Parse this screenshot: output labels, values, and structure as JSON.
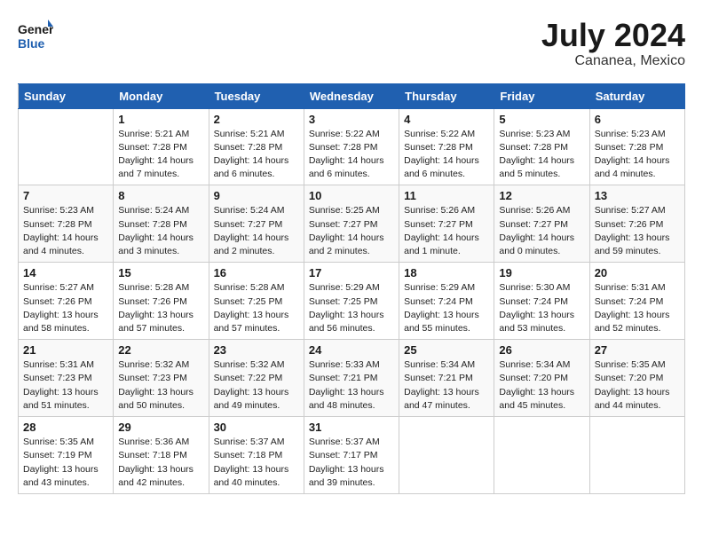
{
  "header": {
    "logo_line1": "General",
    "logo_line2": "Blue",
    "month_title": "July 2024",
    "location": "Cananea, Mexico"
  },
  "weekdays": [
    "Sunday",
    "Monday",
    "Tuesday",
    "Wednesday",
    "Thursday",
    "Friday",
    "Saturday"
  ],
  "weeks": [
    [
      {
        "day": "",
        "info": ""
      },
      {
        "day": "1",
        "info": "Sunrise: 5:21 AM\nSunset: 7:28 PM\nDaylight: 14 hours\nand 7 minutes."
      },
      {
        "day": "2",
        "info": "Sunrise: 5:21 AM\nSunset: 7:28 PM\nDaylight: 14 hours\nand 6 minutes."
      },
      {
        "day": "3",
        "info": "Sunrise: 5:22 AM\nSunset: 7:28 PM\nDaylight: 14 hours\nand 6 minutes."
      },
      {
        "day": "4",
        "info": "Sunrise: 5:22 AM\nSunset: 7:28 PM\nDaylight: 14 hours\nand 6 minutes."
      },
      {
        "day": "5",
        "info": "Sunrise: 5:23 AM\nSunset: 7:28 PM\nDaylight: 14 hours\nand 5 minutes."
      },
      {
        "day": "6",
        "info": "Sunrise: 5:23 AM\nSunset: 7:28 PM\nDaylight: 14 hours\nand 4 minutes."
      }
    ],
    [
      {
        "day": "7",
        "info": "Sunrise: 5:23 AM\nSunset: 7:28 PM\nDaylight: 14 hours\nand 4 minutes."
      },
      {
        "day": "8",
        "info": "Sunrise: 5:24 AM\nSunset: 7:28 PM\nDaylight: 14 hours\nand 3 minutes."
      },
      {
        "day": "9",
        "info": "Sunrise: 5:24 AM\nSunset: 7:27 PM\nDaylight: 14 hours\nand 2 minutes."
      },
      {
        "day": "10",
        "info": "Sunrise: 5:25 AM\nSunset: 7:27 PM\nDaylight: 14 hours\nand 2 minutes."
      },
      {
        "day": "11",
        "info": "Sunrise: 5:26 AM\nSunset: 7:27 PM\nDaylight: 14 hours\nand 1 minute."
      },
      {
        "day": "12",
        "info": "Sunrise: 5:26 AM\nSunset: 7:27 PM\nDaylight: 14 hours\nand 0 minutes."
      },
      {
        "day": "13",
        "info": "Sunrise: 5:27 AM\nSunset: 7:26 PM\nDaylight: 13 hours\nand 59 minutes."
      }
    ],
    [
      {
        "day": "14",
        "info": "Sunrise: 5:27 AM\nSunset: 7:26 PM\nDaylight: 13 hours\nand 58 minutes."
      },
      {
        "day": "15",
        "info": "Sunrise: 5:28 AM\nSunset: 7:26 PM\nDaylight: 13 hours\nand 57 minutes."
      },
      {
        "day": "16",
        "info": "Sunrise: 5:28 AM\nSunset: 7:25 PM\nDaylight: 13 hours\nand 57 minutes."
      },
      {
        "day": "17",
        "info": "Sunrise: 5:29 AM\nSunset: 7:25 PM\nDaylight: 13 hours\nand 56 minutes."
      },
      {
        "day": "18",
        "info": "Sunrise: 5:29 AM\nSunset: 7:24 PM\nDaylight: 13 hours\nand 55 minutes."
      },
      {
        "day": "19",
        "info": "Sunrise: 5:30 AM\nSunset: 7:24 PM\nDaylight: 13 hours\nand 53 minutes."
      },
      {
        "day": "20",
        "info": "Sunrise: 5:31 AM\nSunset: 7:24 PM\nDaylight: 13 hours\nand 52 minutes."
      }
    ],
    [
      {
        "day": "21",
        "info": "Sunrise: 5:31 AM\nSunset: 7:23 PM\nDaylight: 13 hours\nand 51 minutes."
      },
      {
        "day": "22",
        "info": "Sunrise: 5:32 AM\nSunset: 7:23 PM\nDaylight: 13 hours\nand 50 minutes."
      },
      {
        "day": "23",
        "info": "Sunrise: 5:32 AM\nSunset: 7:22 PM\nDaylight: 13 hours\nand 49 minutes."
      },
      {
        "day": "24",
        "info": "Sunrise: 5:33 AM\nSunset: 7:21 PM\nDaylight: 13 hours\nand 48 minutes."
      },
      {
        "day": "25",
        "info": "Sunrise: 5:34 AM\nSunset: 7:21 PM\nDaylight: 13 hours\nand 47 minutes."
      },
      {
        "day": "26",
        "info": "Sunrise: 5:34 AM\nSunset: 7:20 PM\nDaylight: 13 hours\nand 45 minutes."
      },
      {
        "day": "27",
        "info": "Sunrise: 5:35 AM\nSunset: 7:20 PM\nDaylight: 13 hours\nand 44 minutes."
      }
    ],
    [
      {
        "day": "28",
        "info": "Sunrise: 5:35 AM\nSunset: 7:19 PM\nDaylight: 13 hours\nand 43 minutes."
      },
      {
        "day": "29",
        "info": "Sunrise: 5:36 AM\nSunset: 7:18 PM\nDaylight: 13 hours\nand 42 minutes."
      },
      {
        "day": "30",
        "info": "Sunrise: 5:37 AM\nSunset: 7:18 PM\nDaylight: 13 hours\nand 40 minutes."
      },
      {
        "day": "31",
        "info": "Sunrise: 5:37 AM\nSunset: 7:17 PM\nDaylight: 13 hours\nand 39 minutes."
      },
      {
        "day": "",
        "info": ""
      },
      {
        "day": "",
        "info": ""
      },
      {
        "day": "",
        "info": ""
      }
    ]
  ]
}
